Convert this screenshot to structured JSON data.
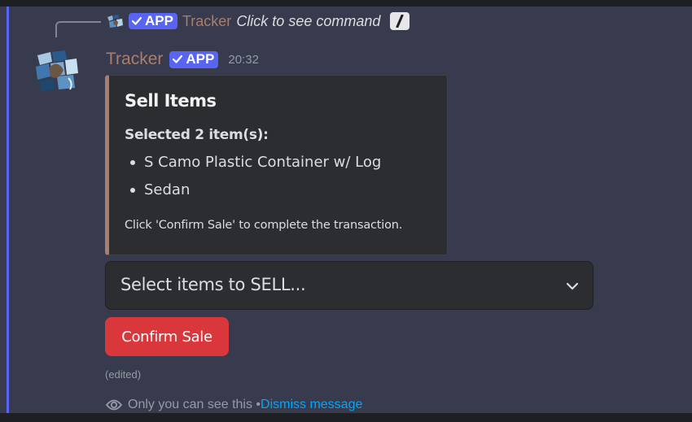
{
  "reply": {
    "app_tag": "APP",
    "name": "Tracker",
    "command_text": "Click to see command",
    "command_icon": "slash-command-icon"
  },
  "message": {
    "author": "Tracker",
    "app_tag": "APP",
    "timestamp": "20:32",
    "avatar_icon": "tracker-bot-avatar"
  },
  "embed": {
    "title": "Sell Items",
    "subtitle": "Selected 2 item(s):",
    "items": [
      "S Camo Plastic Container w/ Log",
      "Sedan"
    ],
    "footer": "Click 'Confirm Sale' to complete the transaction.",
    "accent_color": "#a87f6d"
  },
  "select": {
    "placeholder": "Select items to SELL..."
  },
  "confirm_button": {
    "label": "Confirm Sale",
    "color": "#da373c"
  },
  "edited_label": "(edited)",
  "ephemeral": {
    "notice": "Only you can see this",
    "separator": " • ",
    "dismiss_label": "Dismiss message"
  },
  "colors": {
    "background": "#383a4d",
    "highlight_bar": "#5865f2",
    "app_tag": "#5865f2",
    "link": "#00a8fc"
  }
}
